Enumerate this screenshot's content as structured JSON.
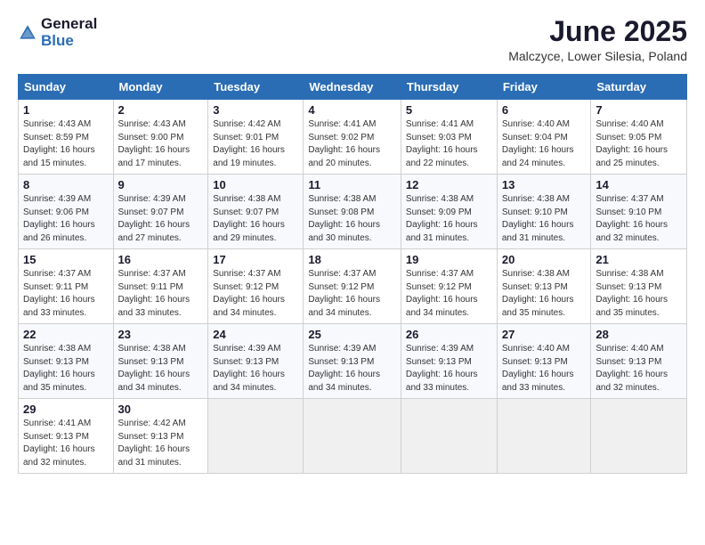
{
  "header": {
    "logo_general": "General",
    "logo_blue": "Blue",
    "month_title": "June 2025",
    "location": "Malczyce, Lower Silesia, Poland"
  },
  "days_of_week": [
    "Sunday",
    "Monday",
    "Tuesday",
    "Wednesday",
    "Thursday",
    "Friday",
    "Saturday"
  ],
  "weeks": [
    [
      {
        "day": 1,
        "sunrise": "4:43 AM",
        "sunset": "8:59 PM",
        "daylight": "16 hours and 15 minutes"
      },
      {
        "day": 2,
        "sunrise": "4:43 AM",
        "sunset": "9:00 PM",
        "daylight": "16 hours and 17 minutes"
      },
      {
        "day": 3,
        "sunrise": "4:42 AM",
        "sunset": "9:01 PM",
        "daylight": "16 hours and 19 minutes"
      },
      {
        "day": 4,
        "sunrise": "4:41 AM",
        "sunset": "9:02 PM",
        "daylight": "16 hours and 20 minutes"
      },
      {
        "day": 5,
        "sunrise": "4:41 AM",
        "sunset": "9:03 PM",
        "daylight": "16 hours and 22 minutes"
      },
      {
        "day": 6,
        "sunrise": "4:40 AM",
        "sunset": "9:04 PM",
        "daylight": "16 hours and 24 minutes"
      },
      {
        "day": 7,
        "sunrise": "4:40 AM",
        "sunset": "9:05 PM",
        "daylight": "16 hours and 25 minutes"
      }
    ],
    [
      {
        "day": 8,
        "sunrise": "4:39 AM",
        "sunset": "9:06 PM",
        "daylight": "16 hours and 26 minutes"
      },
      {
        "day": 9,
        "sunrise": "4:39 AM",
        "sunset": "9:07 PM",
        "daylight": "16 hours and 27 minutes"
      },
      {
        "day": 10,
        "sunrise": "4:38 AM",
        "sunset": "9:07 PM",
        "daylight": "16 hours and 29 minutes"
      },
      {
        "day": 11,
        "sunrise": "4:38 AM",
        "sunset": "9:08 PM",
        "daylight": "16 hours and 30 minutes"
      },
      {
        "day": 12,
        "sunrise": "4:38 AM",
        "sunset": "9:09 PM",
        "daylight": "16 hours and 31 minutes"
      },
      {
        "day": 13,
        "sunrise": "4:38 AM",
        "sunset": "9:10 PM",
        "daylight": "16 hours and 31 minutes"
      },
      {
        "day": 14,
        "sunrise": "4:37 AM",
        "sunset": "9:10 PM",
        "daylight": "16 hours and 32 minutes"
      }
    ],
    [
      {
        "day": 15,
        "sunrise": "4:37 AM",
        "sunset": "9:11 PM",
        "daylight": "16 hours and 33 minutes"
      },
      {
        "day": 16,
        "sunrise": "4:37 AM",
        "sunset": "9:11 PM",
        "daylight": "16 hours and 33 minutes"
      },
      {
        "day": 17,
        "sunrise": "4:37 AM",
        "sunset": "9:12 PM",
        "daylight": "16 hours and 34 minutes"
      },
      {
        "day": 18,
        "sunrise": "4:37 AM",
        "sunset": "9:12 PM",
        "daylight": "16 hours and 34 minutes"
      },
      {
        "day": 19,
        "sunrise": "4:37 AM",
        "sunset": "9:12 PM",
        "daylight": "16 hours and 34 minutes"
      },
      {
        "day": 20,
        "sunrise": "4:38 AM",
        "sunset": "9:13 PM",
        "daylight": "16 hours and 35 minutes"
      },
      {
        "day": 21,
        "sunrise": "4:38 AM",
        "sunset": "9:13 PM",
        "daylight": "16 hours and 35 minutes"
      }
    ],
    [
      {
        "day": 22,
        "sunrise": "4:38 AM",
        "sunset": "9:13 PM",
        "daylight": "16 hours and 35 minutes"
      },
      {
        "day": 23,
        "sunrise": "4:38 AM",
        "sunset": "9:13 PM",
        "daylight": "16 hours and 34 minutes"
      },
      {
        "day": 24,
        "sunrise": "4:39 AM",
        "sunset": "9:13 PM",
        "daylight": "16 hours and 34 minutes"
      },
      {
        "day": 25,
        "sunrise": "4:39 AM",
        "sunset": "9:13 PM",
        "daylight": "16 hours and 34 minutes"
      },
      {
        "day": 26,
        "sunrise": "4:39 AM",
        "sunset": "9:13 PM",
        "daylight": "16 hours and 33 minutes"
      },
      {
        "day": 27,
        "sunrise": "4:40 AM",
        "sunset": "9:13 PM",
        "daylight": "16 hours and 33 minutes"
      },
      {
        "day": 28,
        "sunrise": "4:40 AM",
        "sunset": "9:13 PM",
        "daylight": "16 hours and 32 minutes"
      }
    ],
    [
      {
        "day": 29,
        "sunrise": "4:41 AM",
        "sunset": "9:13 PM",
        "daylight": "16 hours and 32 minutes"
      },
      {
        "day": 30,
        "sunrise": "4:42 AM",
        "sunset": "9:13 PM",
        "daylight": "16 hours and 31 minutes"
      },
      null,
      null,
      null,
      null,
      null
    ]
  ]
}
